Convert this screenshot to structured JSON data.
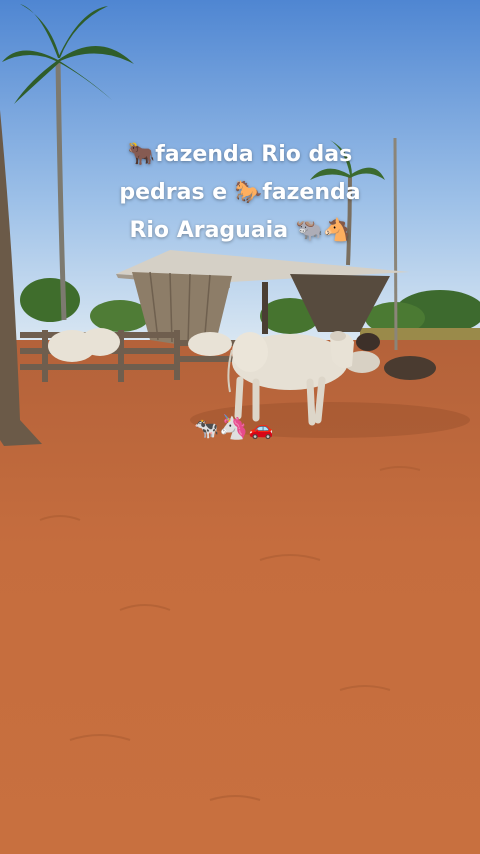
{
  "caption": {
    "line1": "🐂fazenda Rio das",
    "line2": "pedras e 🐎fazenda",
    "line3": "Rio Araguaia 🐃🐴"
  },
  "stickers": [
    "🐄",
    "🦄",
    "🚗"
  ],
  "colors": {
    "sky_top": "#5a8fd6",
    "sky_bottom": "#c9dcef",
    "ground": "#c46a3a",
    "ground_dark": "#a9552c",
    "shed_wood": "#8b7a66",
    "fence": "#6b5b4b",
    "cow": "#e6e0d4"
  }
}
